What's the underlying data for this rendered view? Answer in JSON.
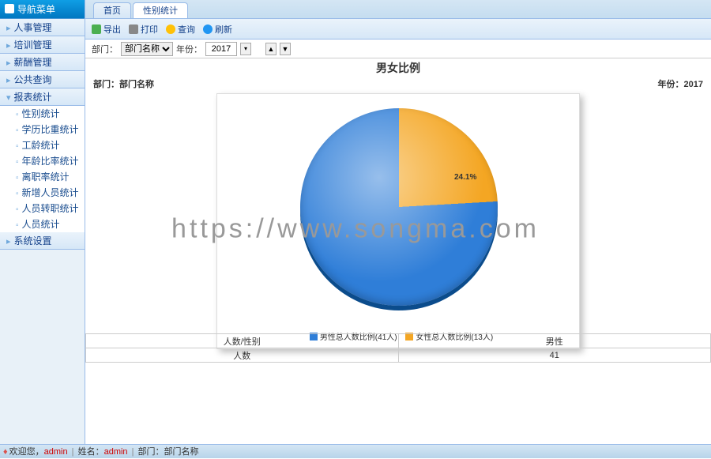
{
  "sidebar": {
    "title": "导航菜单",
    "sections": [
      {
        "label": "人事管理"
      },
      {
        "label": "培训管理"
      },
      {
        "label": "薪酬管理"
      },
      {
        "label": "公共查询"
      },
      {
        "label": "报表统计"
      },
      {
        "label": "系统设置"
      }
    ],
    "submenu": [
      {
        "label": "性别统计"
      },
      {
        "label": "学历比重统计"
      },
      {
        "label": "工龄统计"
      },
      {
        "label": "年龄比率统计"
      },
      {
        "label": "离职率统计"
      },
      {
        "label": "新增人员统计"
      },
      {
        "label": "人员转职统计"
      },
      {
        "label": "人员统计"
      }
    ]
  },
  "tabs": [
    {
      "label": "首页"
    },
    {
      "label": "性别统计"
    }
  ],
  "toolbar": {
    "export": "导出",
    "print": "打印",
    "search": "查询",
    "refresh": "刷新"
  },
  "filter": {
    "dept_label": "部门：",
    "dept_value": "部门名称",
    "year_label": "年份：",
    "year_value": "2017",
    "spin_up": "▲",
    "spin_down": "▼"
  },
  "chart_data": {
    "type": "pie",
    "title": "男女比例",
    "subtitle_left": "部门：部门名称",
    "subtitle_right": "年份：2017",
    "series": [
      {
        "name": "男性总人数比例(41人)",
        "value": 41,
        "pct": 75.9,
        "color": "#2f7ed8"
      },
      {
        "name": "女性总人数比例(13人)",
        "value": 13,
        "pct": 24.1,
        "color": "#f4a623"
      }
    ],
    "slice_label": "24.1%"
  },
  "table": {
    "header_metric": "人数/性别",
    "header_gender": "男性",
    "row_metric": "人数",
    "row_value": "41"
  },
  "footer": {
    "welcome": "欢迎您，",
    "user": "admin",
    "name_label": "姓名：",
    "name_value": "admin",
    "dept_label": "部门：",
    "dept_value": "部门名称"
  },
  "watermark": "https://www.songma.com"
}
